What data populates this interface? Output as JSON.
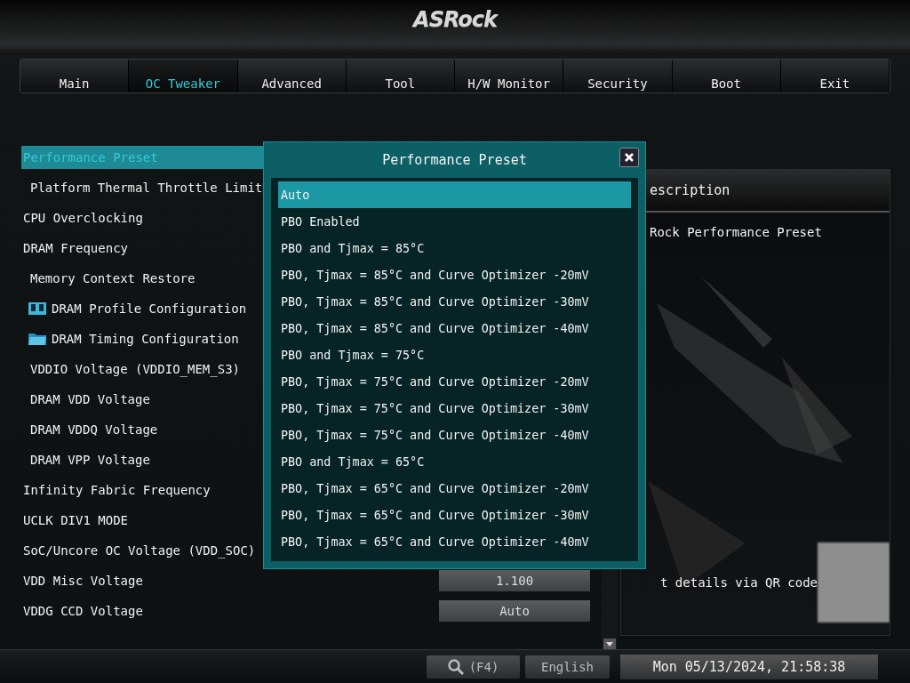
{
  "logo": "ASRock",
  "tabs": [
    {
      "label": "Main",
      "selected": false
    },
    {
      "label": "OC Tweaker",
      "selected": true
    },
    {
      "label": "Advanced",
      "selected": false
    },
    {
      "label": "Tool",
      "selected": false
    },
    {
      "label": "H/W Monitor",
      "selected": false
    },
    {
      "label": "Security",
      "selected": false
    },
    {
      "label": "Boot",
      "selected": false
    },
    {
      "label": "Exit",
      "selected": false
    }
  ],
  "settings": [
    {
      "label": "Performance Preset",
      "selected": true,
      "kind": "item"
    },
    {
      "label": "Platform Thermal Throttle Limit",
      "selected": false,
      "kind": "subitem"
    },
    {
      "label": "CPU Overclocking",
      "selected": false,
      "kind": "item"
    },
    {
      "label": "DRAM Frequency",
      "selected": false,
      "kind": "item"
    },
    {
      "label": "Memory Context Restore",
      "selected": false,
      "kind": "subitem"
    },
    {
      "label": "DRAM Profile Configuration",
      "selected": false,
      "kind": "profile"
    },
    {
      "label": "DRAM Timing Configuration",
      "selected": false,
      "kind": "folder"
    },
    {
      "label": "VDDIO Voltage (VDDIO_MEM_S3)",
      "selected": false,
      "kind": "subitem"
    },
    {
      "label": "DRAM VDD Voltage",
      "selected": false,
      "kind": "subitem"
    },
    {
      "label": "DRAM VDDQ Voltage",
      "selected": false,
      "kind": "subitem"
    },
    {
      "label": "DRAM VPP Voltage",
      "selected": false,
      "kind": "subitem"
    },
    {
      "label": "Infinity Fabric Frequency",
      "selected": false,
      "kind": "item"
    },
    {
      "label": "UCLK DIV1 MODE",
      "selected": false,
      "kind": "item"
    },
    {
      "label": "SoC/Uncore OC Voltage (VDD_SOC)",
      "selected": false,
      "kind": "item"
    },
    {
      "label": "VDD Misc Voltage",
      "selected": false,
      "kind": "item",
      "value": "1.100"
    },
    {
      "label": "VDDG CCD Voltage",
      "selected": false,
      "kind": "item",
      "value": "Auto"
    }
  ],
  "description": {
    "title": "escription",
    "text": "Rock Performance Preset",
    "qr_text": "t details via QR code"
  },
  "dialog": {
    "title": "Performance Preset",
    "options": [
      {
        "label": "Auto",
        "selected": true
      },
      {
        "label": "PBO Enabled",
        "selected": false
      },
      {
        "label": "PBO and Tjmax = 85°C",
        "selected": false
      },
      {
        "label": "PBO, Tjmax = 85°C and Curve Optimizer -20mV",
        "selected": false
      },
      {
        "label": "PBO, Tjmax = 85°C and Curve Optimizer -30mV",
        "selected": false
      },
      {
        "label": "PBO, Tjmax = 85°C and Curve Optimizer -40mV",
        "selected": false
      },
      {
        "label": "PBO and Tjmax = 75°C",
        "selected": false
      },
      {
        "label": "PBO, Tjmax = 75°C and Curve Optimizer -20mV",
        "selected": false
      },
      {
        "label": "PBO, Tjmax = 75°C and Curve Optimizer -30mV",
        "selected": false
      },
      {
        "label": "PBO, Tjmax = 75°C and Curve Optimizer -40mV",
        "selected": false
      },
      {
        "label": "PBO and Tjmax = 65°C",
        "selected": false
      },
      {
        "label": "PBO, Tjmax = 65°C and Curve Optimizer -20mV",
        "selected": false
      },
      {
        "label": "PBO, Tjmax = 65°C and Curve Optimizer -30mV",
        "selected": false
      },
      {
        "label": "PBO, Tjmax = 65°C and Curve Optimizer -40mV",
        "selected": false
      }
    ]
  },
  "status_bar": {
    "search_key": "(F4)",
    "language": "English",
    "datetime": "Mon 05/13/2024, 21:58:38"
  }
}
